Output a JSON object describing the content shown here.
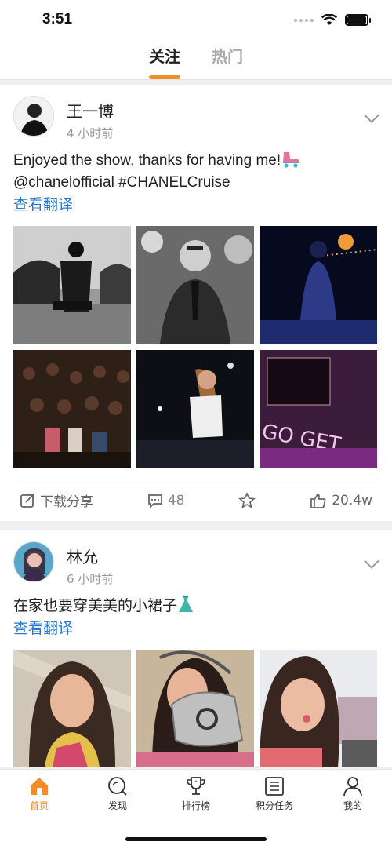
{
  "status": {
    "time": "3:51"
  },
  "tabs": [
    {
      "label": "关注",
      "active": true
    },
    {
      "label": "热门",
      "active": false
    }
  ],
  "posts": [
    {
      "user": "王一博",
      "time": "4 小时前",
      "text_line1": "Enjoyed the show, thanks for having me!",
      "text_line1_emoji": "roller-skate",
      "text_line2": "@chanelofficial #CHANELCruise",
      "translate": "查看翻译",
      "actions": {
        "download_share": "下载分享",
        "comments": "48",
        "likes": "20.4w"
      }
    },
    {
      "user": "林允",
      "time": "6 小时前",
      "text_line1": "在家也要穿美美的小裙子",
      "text_line1_emoji": "dress",
      "translate": "查看翻译"
    }
  ],
  "tab_bar": [
    {
      "label": "首页",
      "icon": "home-icon",
      "active": true
    },
    {
      "label": "发现",
      "icon": "discover-icon",
      "active": false
    },
    {
      "label": "排行榜",
      "icon": "trophy-icon",
      "active": false
    },
    {
      "label": "积分任务",
      "icon": "task-list-icon",
      "active": false
    },
    {
      "label": "我的",
      "icon": "profile-icon",
      "active": false
    }
  ],
  "colors": {
    "accent": "#f28c28",
    "link": "#2a78d1"
  }
}
